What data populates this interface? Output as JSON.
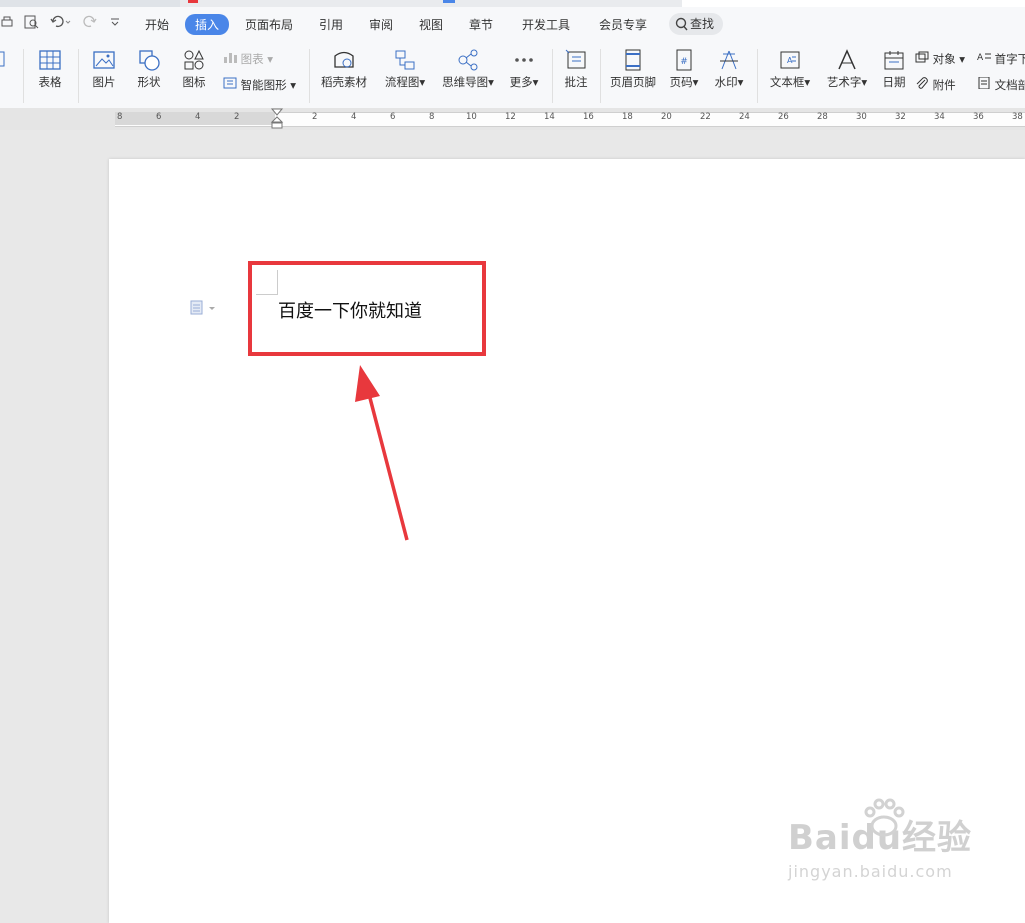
{
  "menu": {
    "items": [
      "开始",
      "插入",
      "页面布局",
      "引用",
      "审阅",
      "视图",
      "章节",
      "开发工具",
      "会员专享"
    ],
    "active": "插入",
    "search_label": "查找"
  },
  "toolbar": {
    "table": "表格",
    "picture": "图片",
    "shape": "形状",
    "icon": "图标",
    "chart": "图表",
    "smart_graphic": "智能图形",
    "docer_material": "稻壳素材",
    "flowchart": "流程图",
    "mindmap": "思维导图",
    "more": "更多",
    "comment": "批注",
    "header_footer": "页眉页脚",
    "page_number": "页码",
    "watermark": "水印",
    "textbox": "文本框",
    "wordart": "艺术字",
    "date": "日期",
    "object": "对象",
    "attachment": "附件",
    "dropcap": "首字下沉",
    "docpart": "文档部件"
  },
  "ruler": {
    "left_numbers": [
      "8",
      "6",
      "4",
      "2"
    ],
    "right_numbers": [
      "2",
      "4",
      "6",
      "8",
      "10",
      "12",
      "14",
      "16",
      "18",
      "20",
      "22",
      "24",
      "26",
      "28",
      "30",
      "32",
      "34",
      "36",
      "38"
    ]
  },
  "document": {
    "text": "百度一下你就知道"
  },
  "annotation": {
    "highlight_color": "#e8383d"
  },
  "watermark": {
    "brand": "Baidu经验",
    "url": "jingyan.baidu.com"
  }
}
